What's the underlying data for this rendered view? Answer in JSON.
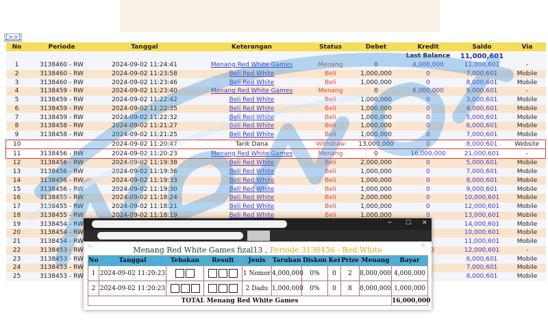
{
  "nav": {
    "expand_label": "[>>]"
  },
  "ledger": {
    "headers": [
      "No",
      "Periode",
      "Tanggal",
      "Keterangan",
      "Status",
      "Debet",
      "Kredit",
      "Saldo",
      "Via"
    ],
    "last_balance_label": "Last Balance",
    "last_balance_value": "11,000,601",
    "rows": [
      {
        "no": "1",
        "periode": "3138460 - RW",
        "tanggal": "2024-09-02 11:24:41",
        "ket": "Menang Red White Games",
        "ket_link": true,
        "status": "Menang",
        "debet": "0",
        "kredit": "4,000,000",
        "saldo": "11,000,601",
        "via": "-"
      },
      {
        "no": "2",
        "periode": "3138460 - RW",
        "tanggal": "2024-09-02 11:23:58",
        "ket": "Beli Red White",
        "ket_link": true,
        "status": "Beli",
        "debet": "1,000,000",
        "kredit": "0",
        "saldo": "7,000,601",
        "via": "Mobile"
      },
      {
        "no": "3",
        "periode": "3138460 - RW",
        "tanggal": "2024-09-02 11:23:46",
        "ket": "Beli Red White",
        "ket_link": true,
        "status": "Beli",
        "debet": "1,000,000",
        "kredit": "0",
        "saldo": "8,000,601",
        "via": "Mobile"
      },
      {
        "no": "4",
        "periode": "3138459 - RW",
        "tanggal": "2024-09-02 11:23:40",
        "ket": "Menang Red White Games",
        "ket_link": true,
        "status": "Menang",
        "debet": "0",
        "kredit": "6,000,000",
        "saldo": "9,000,601",
        "via": "-"
      },
      {
        "no": "5",
        "periode": "3138459 - RW",
        "tanggal": "2024-09-02 11:22:42",
        "ket": "Beli Red White",
        "ket_link": true,
        "status": "Beli",
        "debet": "1,000,000",
        "kredit": "0",
        "saldo": "3,000,601",
        "via": "Mobile"
      },
      {
        "no": "6",
        "periode": "3138459 - RW",
        "tanggal": "2024-09-02 11:22:35",
        "ket": "Beli Red White",
        "ket_link": true,
        "status": "Beli",
        "debet": "1,000,000",
        "kredit": "0",
        "saldo": "4,000,601",
        "via": "Mobile"
      },
      {
        "no": "7",
        "periode": "3138459 - RW",
        "tanggal": "2024-09-02 11:22:32",
        "ket": "Beli Red White",
        "ket_link": true,
        "status": "Beli",
        "debet": "1,000,000",
        "kredit": "0",
        "saldo": "5,000,601",
        "via": "Mobile"
      },
      {
        "no": "8",
        "periode": "3138458 - RW",
        "tanggal": "2024-09-02 11:21:27",
        "ket": "Beli Red White",
        "ket_link": true,
        "status": "Beli",
        "debet": "1,000,000",
        "kredit": "0",
        "saldo": "6,000,601",
        "via": "Mobile"
      },
      {
        "no": "9",
        "periode": "3138458 - RW",
        "tanggal": "2024-09-02 11:21:25",
        "ket": "Beli Red White",
        "ket_link": true,
        "status": "Beli",
        "debet": "1,000,000",
        "kredit": "0",
        "saldo": "7,000,601",
        "via": "Mobile"
      },
      {
        "no": "10",
        "periode": "",
        "tanggal": "2024-09-02 11:20:47",
        "ket": "Tarik Dana",
        "ket_link": false,
        "status": "Withdraw",
        "debet": "13,000,000",
        "kredit": "0",
        "saldo": "8,000,601",
        "via": "Website"
      },
      {
        "no": "11",
        "periode": "3138456 - RW",
        "tanggal": "2024-09-02 11:20:23",
        "ket": "Menang Red White Games",
        "ket_link": true,
        "status": "Menang",
        "debet": "0",
        "kredit": "16,000,000",
        "saldo": "21,000,601",
        "via": "-"
      },
      {
        "no": "12",
        "periode": "3138456 - RW",
        "tanggal": "2024-09-02 11:19:38",
        "ket": "Beli Red White",
        "ket_link": true,
        "status": "Beli",
        "debet": "2,000,000",
        "kredit": "0",
        "saldo": "5,000,601",
        "via": "Mobile"
      },
      {
        "no": "13",
        "periode": "3138456 - RW",
        "tanggal": "2024-09-02 11:19:36",
        "ket": "Beli Red White",
        "ket_link": true,
        "status": "Beli",
        "debet": "1,000,000",
        "kredit": "0",
        "saldo": "7,000,601",
        "via": "Mobile"
      },
      {
        "no": "14",
        "periode": "3138456 - RW",
        "tanggal": "2024-09-02 11:19:33",
        "ket": "Beli Red White",
        "ket_link": true,
        "status": "Beli",
        "debet": "1,000,000",
        "kredit": "0",
        "saldo": "8,000,601",
        "via": "Mobile"
      },
      {
        "no": "15",
        "periode": "3138456 - RW",
        "tanggal": "2024-09-02 11:19:30",
        "ket": "Beli Red White",
        "ket_link": true,
        "status": "Beli",
        "debet": "1,000,000",
        "kredit": "0",
        "saldo": "9,000,601",
        "via": "Mobile"
      },
      {
        "no": "16",
        "periode": "3138455 - RW",
        "tanggal": "2024-09-02 11:18:24",
        "ket": "Beli Red White",
        "ket_link": true,
        "status": "Beli",
        "debet": "2,000,000",
        "kredit": "0",
        "saldo": "10,000,601",
        "via": "Mobile"
      },
      {
        "no": "17",
        "periode": "3138455 - RW",
        "tanggal": "2024-09-02 11:18:21",
        "ket": "Beli Red White",
        "ket_link": true,
        "status": "Beli",
        "debet": "1,000,000",
        "kredit": "0",
        "saldo": "12,000,601",
        "via": "Mobile"
      },
      {
        "no": "18",
        "periode": "3138455 - RW",
        "tanggal": "2024-09-02 11:18:19",
        "ket": "Beli Red White",
        "ket_link": true,
        "status": "Beli",
        "debet": "1,000,000",
        "kredit": "0",
        "saldo": "13,000,601",
        "via": "Mobile"
      },
      {
        "no": "19",
        "periode": "3138454 - RW",
        "tanggal": "",
        "ket": "",
        "ket_link": false,
        "status": "",
        "debet": "",
        "kredit": "0",
        "saldo": "14,000,601",
        "via": "Mobile"
      },
      {
        "no": "20",
        "periode": "3138454 - RW",
        "tanggal": "",
        "ket": "",
        "ket_link": false,
        "status": "",
        "debet": "",
        "kredit": "0",
        "saldo": "10,000,601",
        "via": "Mobile"
      },
      {
        "no": "21",
        "periode": "3138454 - RW",
        "tanggal": "",
        "ket": "",
        "ket_link": false,
        "status": "",
        "debet": "",
        "kredit": "0",
        "saldo": "11,000,601",
        "via": "Mobile"
      },
      {
        "no": "22",
        "periode": "3138453 - RW",
        "tanggal": "",
        "ket": "",
        "ket_link": false,
        "status": "",
        "debet": "",
        "kredit": "000",
        "saldo": "12,000,601",
        "via": "-"
      },
      {
        "no": "23",
        "periode": "3138453 - RW",
        "tanggal": "",
        "ket": "",
        "ket_link": false,
        "status": "",
        "debet": "",
        "kredit": "0",
        "saldo": "6,000,601",
        "via": "Mobile"
      },
      {
        "no": "24",
        "periode": "3138453 - RW",
        "tanggal": "",
        "ket": "",
        "ket_link": false,
        "status": "",
        "debet": "",
        "kredit": "0",
        "saldo": "7,000,601",
        "via": "Mobile"
      },
      {
        "no": "25",
        "periode": "3138453 - RW",
        "tanggal": "",
        "ket": "",
        "ket_link": false,
        "status": "",
        "debet": "",
        "kredit": "0",
        "saldo": "8,000,601",
        "via": "Mobile"
      }
    ]
  },
  "popup": {
    "title_prefix": "Menang Red White Games fizal13 ,",
    "title_period": "Periode 3138456 - Red White",
    "window_controls": {
      "minimize": "─",
      "maximize": "☐",
      "close": "✕"
    },
    "headers": [
      "No",
      "Tanggal",
      "Tebakan",
      "Result",
      "Jenis",
      "Taruhan",
      "Diskon",
      "Kei",
      "Prize",
      "Menang",
      "Bayar"
    ],
    "rows": [
      {
        "no": "1",
        "tanggal": "2024-09-02 11:20:23",
        "tebakan_boxes": 2,
        "result_boxes": 3,
        "jenis": "1 Nomor",
        "taruhan": "4,000,000",
        "diskon": "0%",
        "kei": "0",
        "prize": "2",
        "menang": "8,000,000",
        "bayar": "4,000,000"
      },
      {
        "no": "2",
        "tanggal": "2024-09-02 11:20:23",
        "tebakan_boxes": 3,
        "result_boxes": 3,
        "jenis": "2 Dadu",
        "taruhan": "1,000,000",
        "diskon": "0%",
        "kei": "0",
        "prize": "8",
        "menang": "8,000,000",
        "bayar": "1,000,000"
      }
    ],
    "total_label": "TOTAL  Menang Red White Games",
    "total_value": "16,000,000"
  },
  "colors": {
    "header_bg": "#f5dc5a",
    "row_odd": "#f3f5fb",
    "row_even": "#fbe4ce",
    "highlight_border": "#d63b3b",
    "link_blue": "#3b3bc4",
    "status_red": "#d64a3a",
    "popup_header_bg": "#4aaed8",
    "period_orange": "#e8a020"
  }
}
